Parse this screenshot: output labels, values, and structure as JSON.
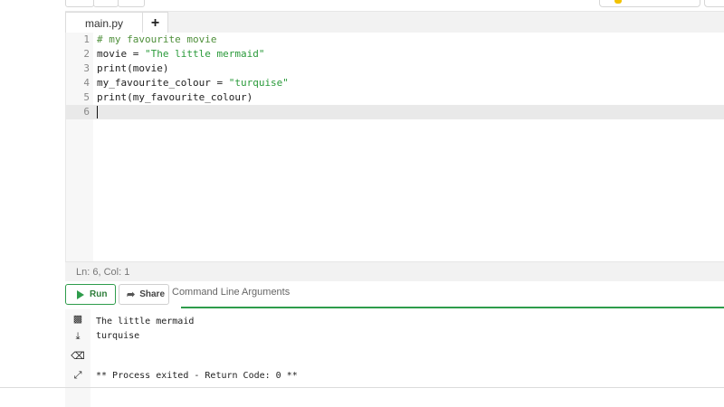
{
  "tabs": {
    "active_file": "main.py",
    "add_label": "+"
  },
  "editor": {
    "lines": [
      {
        "num": "1",
        "tokens": [
          {
            "t": "# my favourite movie",
            "k": "comment"
          }
        ]
      },
      {
        "num": "2",
        "tokens": [
          {
            "t": "movie = ",
            "k": "plain"
          },
          {
            "t": "\"The little mermaid\"",
            "k": "string"
          }
        ]
      },
      {
        "num": "3",
        "tokens": [
          {
            "t": "print(movie)",
            "k": "plain"
          }
        ]
      },
      {
        "num": "4",
        "tokens": [
          {
            "t": "my_favourite_colour = ",
            "k": "plain"
          },
          {
            "t": "\"turquise\"",
            "k": "string"
          }
        ]
      },
      {
        "num": "5",
        "tokens": [
          {
            "t": "print(my_favourite_colour)",
            "k": "plain"
          }
        ]
      },
      {
        "num": "6",
        "tokens": [],
        "active": true
      }
    ]
  },
  "status": {
    "position": "Ln: 6,  Col: 1"
  },
  "actions": {
    "run_label": "Run",
    "share_label": "Share",
    "args_placeholder": "Command Line Arguments"
  },
  "output": {
    "lines": [
      "The little mermaid",
      "turquise",
      "",
      "",
      "** Process exited - Return Code: 0 **"
    ]
  },
  "colors": {
    "accent_green": "#2e9c4b",
    "comment": "#4e8f3a",
    "string": "#2a9a3a"
  },
  "icons": {
    "output_toolbar": [
      "copy-icon",
      "download-icon",
      "clear-icon",
      "expand-icon"
    ]
  }
}
